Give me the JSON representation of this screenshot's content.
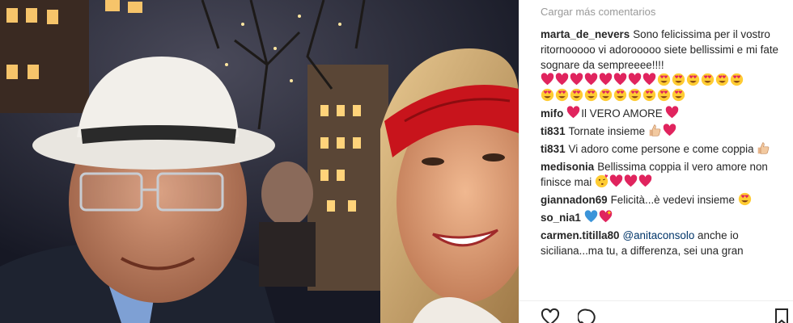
{
  "photo": {
    "alt_icon": "selfie-photo"
  },
  "panel": {
    "load_more": "Cargar más comentarios",
    "comments": [
      {
        "user": "marta_de_nevers",
        "text": "Sono felicissima per il vostro ritornooooo vi adorooooo siete bellissimi e mi fate sognare da sempreeee!!!!",
        "emoji_rows": [
          [
            "heart",
            "heart",
            "heart",
            "heart",
            "heart",
            "heart",
            "heart",
            "heart",
            "heart-eyes",
            "heart-eyes",
            "heart-eyes",
            "heart-eyes",
            "heart-eyes",
            "heart-eyes"
          ],
          [
            "heart-eyes",
            "heart-eyes",
            "heart-eyes",
            "heart-eyes",
            "heart-eyes",
            "heart-eyes",
            "heart-eyes",
            "heart-eyes",
            "heart-eyes",
            "heart-eyes"
          ]
        ]
      },
      {
        "user": "mifo",
        "text": "Il VERO AMORE",
        "emoji_before": [
          "heart"
        ],
        "emoji_after": [
          "heart"
        ]
      },
      {
        "user": "ti831",
        "text": "Tornate insieme",
        "emoji_after": [
          "thumbs-up",
          "heart"
        ]
      },
      {
        "user": "ti831",
        "text": "Vi adoro come persone e come coppia",
        "emoji_after": [
          "thumbs-up"
        ]
      },
      {
        "user": "medisonia",
        "text": "Bellissima coppia il vero amore non finisce mai",
        "emoji_after": [
          "kiss-face",
          "heart",
          "heart",
          "heart"
        ]
      },
      {
        "user": "giannadon69",
        "text": "Felicità...è vedevi insieme",
        "emoji_after": [
          "heart-eyes"
        ]
      },
      {
        "user": "so_nia1",
        "text": "",
        "emoji_after": [
          "blue-heart",
          "sparkling-heart"
        ]
      },
      {
        "user": "carmen.titilla80",
        "mention": "@anitaconsolo",
        "text": "anche io siciliana...ma tu, a differenza, sei una gran"
      }
    ]
  },
  "actions": {
    "like_icon": "heart-outline-icon",
    "comment_icon": "comment-icon",
    "save_icon": "bookmark-icon"
  },
  "colors": {
    "username": "#262626",
    "muted": "#999999",
    "mention": "#003569",
    "heart": "#e0245e"
  }
}
